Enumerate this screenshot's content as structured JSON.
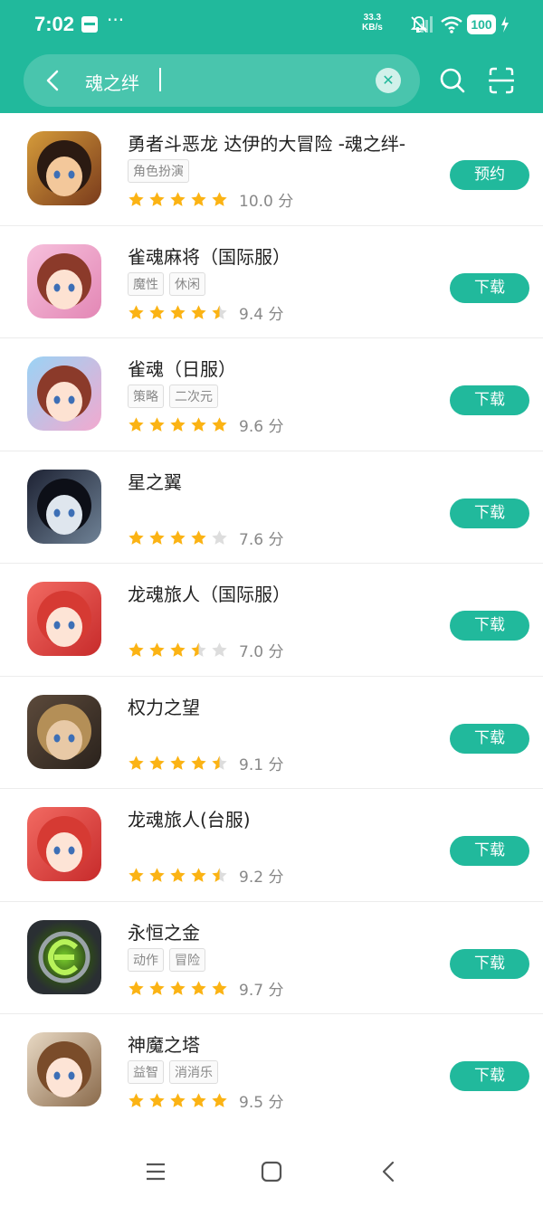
{
  "status_bar": {
    "time": "7:02",
    "net_speed_value": "33.3",
    "net_speed_unit": "KB/s",
    "battery": "100"
  },
  "search": {
    "query": "魂之绊"
  },
  "colors": {
    "accent": "#21b99c",
    "star_filled": "#fbb314",
    "star_empty": "#dddddd"
  },
  "apps": [
    {
      "name": "勇者斗恶龙 达伊的大冒险 -魂之绊-",
      "tags": [
        "角色扮演"
      ],
      "rating": 5,
      "score": "10.0 分",
      "action": "预约",
      "icon": "dragon-quest-dai-icon"
    },
    {
      "name": "雀魂麻将（国际服）",
      "tags": [
        "魔性",
        "休闲"
      ],
      "rating": 4.5,
      "score": "9.4 分",
      "action": "下载",
      "icon": "mahjong-soul-global-icon"
    },
    {
      "name": "雀魂（日服）",
      "tags": [
        "策略",
        "二次元"
      ],
      "rating": 5,
      "score": "9.6 分",
      "action": "下载",
      "icon": "mahjong-soul-jp-icon"
    },
    {
      "name": "星之翼",
      "tags": [],
      "rating": 4,
      "score": "7.6 分",
      "action": "下载",
      "icon": "star-wings-icon"
    },
    {
      "name": "龙魂旅人（国际服）",
      "tags": [],
      "rating": 3.5,
      "score": "7.0 分",
      "action": "下载",
      "icon": "dragon-soul-traveler-global-icon"
    },
    {
      "name": "权力之望",
      "tags": [],
      "rating": 4.5,
      "score": "9.1 分",
      "action": "下载",
      "icon": "power-hope-icon"
    },
    {
      "name": "龙魂旅人(台服)",
      "tags": [],
      "rating": 4.5,
      "score": "9.2 分",
      "action": "下载",
      "icon": "dragon-soul-traveler-tw-icon"
    },
    {
      "name": "永恒之金",
      "tags": [
        "动作",
        "冒险"
      ],
      "rating": 5,
      "score": "9.7 分",
      "action": "下载",
      "icon": "eternal-gold-icon"
    },
    {
      "name": "神魔之塔",
      "tags": [
        "益智",
        "消消乐"
      ],
      "rating": 5,
      "score": "9.5 分",
      "action": "下载",
      "icon": "tower-of-saviors-icon"
    }
  ]
}
